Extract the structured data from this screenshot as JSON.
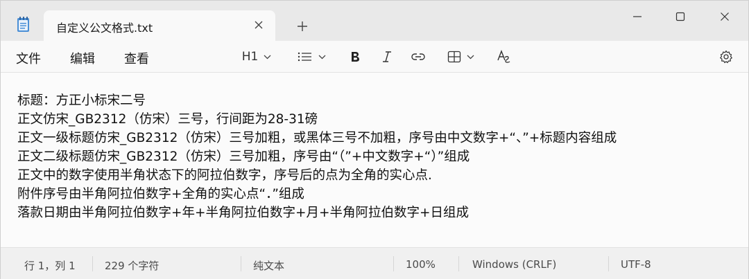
{
  "tab": {
    "title": "自定义公文格式.txt"
  },
  "menu": {
    "file": "文件",
    "edit": "编辑",
    "view": "查看"
  },
  "toolbar": {
    "heading": "H1"
  },
  "editor": {
    "lines": [
      "标题：方正小标宋二号",
      "正文仿宋_GB2312（仿宋）三号，行间距为28-31磅",
      "正文一级标题仿宋_GB2312（仿宋）三号加粗，或黑体三号不加粗，序号由中文数字+“、”+标题内容组成",
      "正文二级标题仿宋_GB2312（仿宋）三号加粗，序号由“（”+中文数字+“）”组成",
      "正文中的数字使用半角状态下的阿拉伯数字，序号后的点为全角的实心点.",
      "附件序号由半角阿拉伯数字+全角的实心点“．”组成",
      "落款日期由半角阿拉伯数字+年+半角阿拉伯数字+月+半角阿拉伯数字+日组成"
    ]
  },
  "status": {
    "position": "行 1，列 1",
    "chars": "229 个字符",
    "format": "纯文本",
    "zoom": "100%",
    "line_ending": "Windows (CRLF)",
    "encoding": "UTF-8"
  },
  "icons": {
    "app": "notepad-icon",
    "close_tab": "close-icon",
    "new_tab": "plus-icon",
    "minimize": "minimize-icon",
    "maximize": "maximize-icon",
    "close_window": "close-icon",
    "heading": "chevron-down-icon",
    "list": "list-icon",
    "bold": "bold-icon",
    "italic": "italic-icon",
    "link": "link-icon",
    "table": "table-icon",
    "clear_format": "clear-formatting-icon",
    "settings": "gear-icon"
  }
}
